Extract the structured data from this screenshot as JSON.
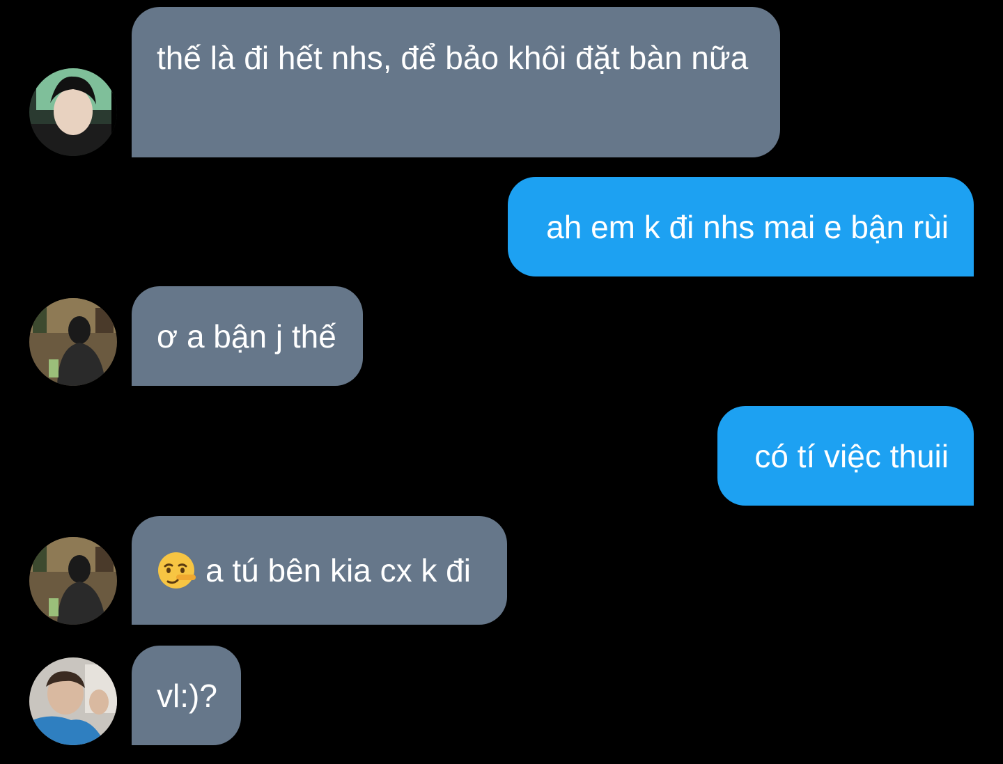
{
  "messages": [
    {
      "side": "incoming",
      "text": "thế là đi hết nhs, để bảo khôi đặt bàn nữa"
    },
    {
      "side": "outgoing",
      "text": "ah em k đi nhs mai e bận rùi"
    },
    {
      "side": "incoming",
      "text": "ơ a bận j thế"
    },
    {
      "side": "outgoing",
      "text": "có tí việc thuii"
    },
    {
      "side": "incoming",
      "emoji": "lying-face-emoji",
      "text": "a tú bên kia cx k đi"
    },
    {
      "side": "incoming",
      "text": "vl:)?"
    }
  ],
  "colors": {
    "background": "#000000",
    "incoming_bubble": "#66778a",
    "outgoing_bubble": "#1da1f2",
    "text": "#ffffff"
  }
}
